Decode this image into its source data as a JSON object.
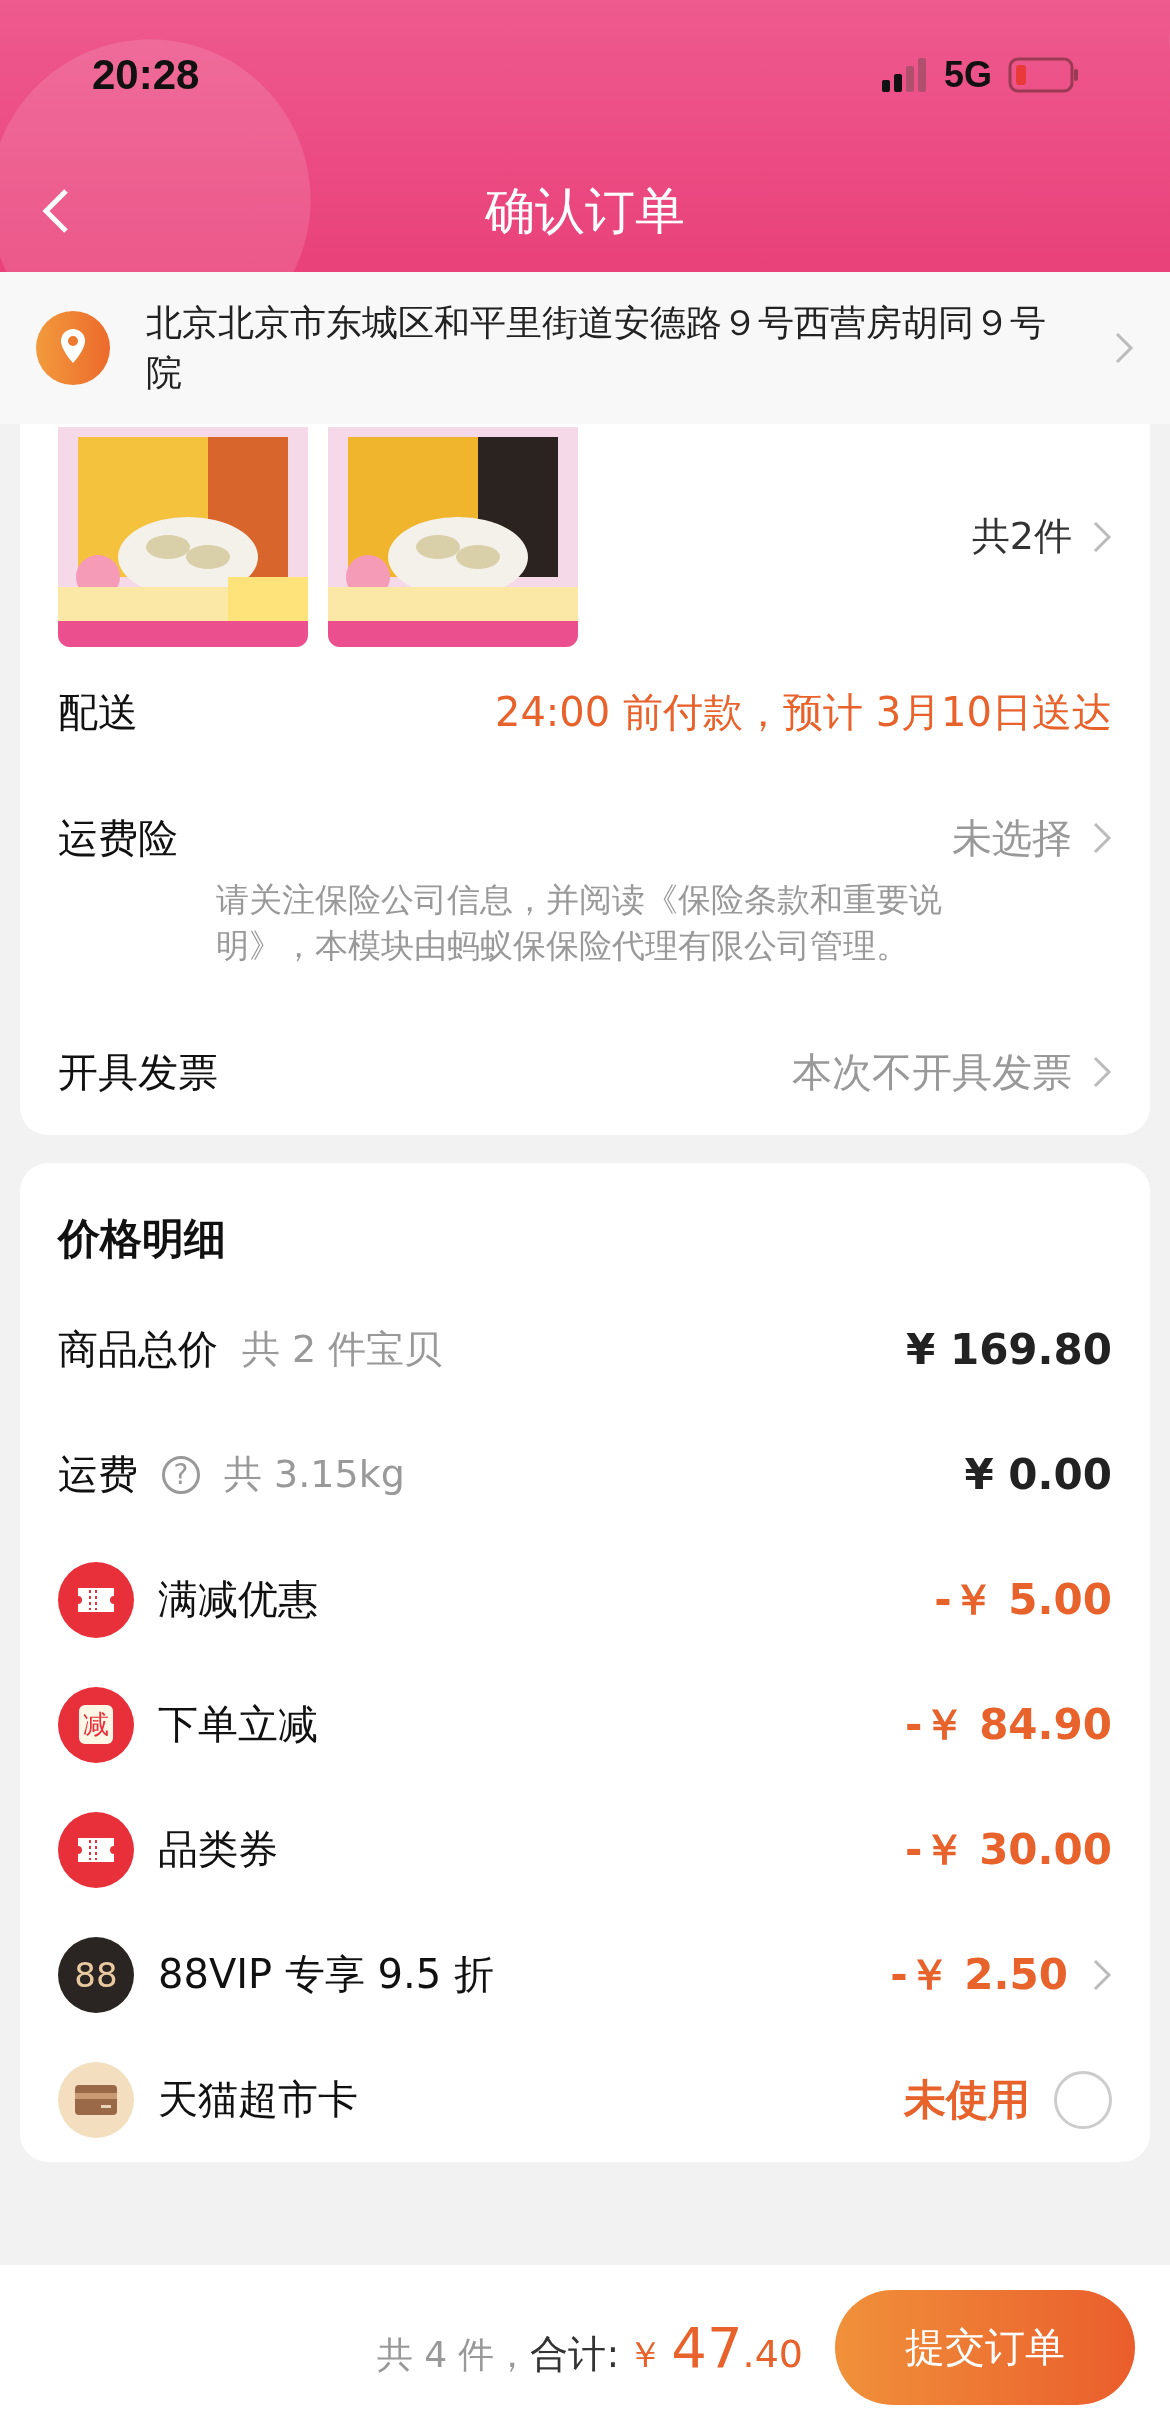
{
  "status_bar": {
    "time": "20:28",
    "network": "5G"
  },
  "header": {
    "title": "确认订单"
  },
  "address": {
    "text": "北京北京市东城区和平里街道安德路９号西营房胡同９号院"
  },
  "products": {
    "count": "共2件"
  },
  "order_rows": [
    {
      "label": "配送",
      "value": "24:00 前付款，预计 3月10日送达",
      "emphasis": true,
      "arrow": false
    },
    {
      "label": "运费险",
      "value": "未选择",
      "emphasis": false,
      "arrow": true,
      "note": "请关注保险公司信息，并阅读《保险条款和重要说明》，本模块由蚂蚁保保险代理有限公司管理。"
    },
    {
      "label": "开具发票",
      "value": "本次不开具发票",
      "emphasis": false,
      "arrow": true
    }
  ],
  "price_detail": {
    "title": "价格明细",
    "rows": [
      {
        "kind": "plain",
        "label": "商品总价",
        "sub": "共 2 件宝贝",
        "value": "¥ 169.80",
        "emphasis": false,
        "arrow": false
      },
      {
        "kind": "help",
        "label": "运费",
        "sub": "共 3.15kg",
        "help": "?",
        "value": "¥ 0.00",
        "emphasis": false,
        "arrow": false
      },
      {
        "kind": "coupon",
        "label": "满减优惠",
        "value": "-￥ 5.00",
        "emphasis": true,
        "arrow": false
      },
      {
        "kind": "badge",
        "badge": "减",
        "label": "下单立减",
        "value": "-￥ 84.90",
        "emphasis": true,
        "arrow": false
      },
      {
        "kind": "coupon",
        "label": "品类券",
        "value": "-￥ 30.00",
        "emphasis": true,
        "arrow": false
      },
      {
        "kind": "vip",
        "badge": "88",
        "label": "88VIP 专享 9.5 折",
        "value": "-￥ 2.50",
        "emphasis": true,
        "arrow": true
      },
      {
        "kind": "card",
        "label": "天猫超市卡",
        "value": "未使用",
        "emphasis": true,
        "arrow": false,
        "checked": false
      }
    ]
  },
  "footer": {
    "count": "共 4 件，",
    "total_label": "合计:",
    "currency": "￥",
    "amount": "47",
    "decimals": ".40",
    "submit": "提交订单"
  }
}
